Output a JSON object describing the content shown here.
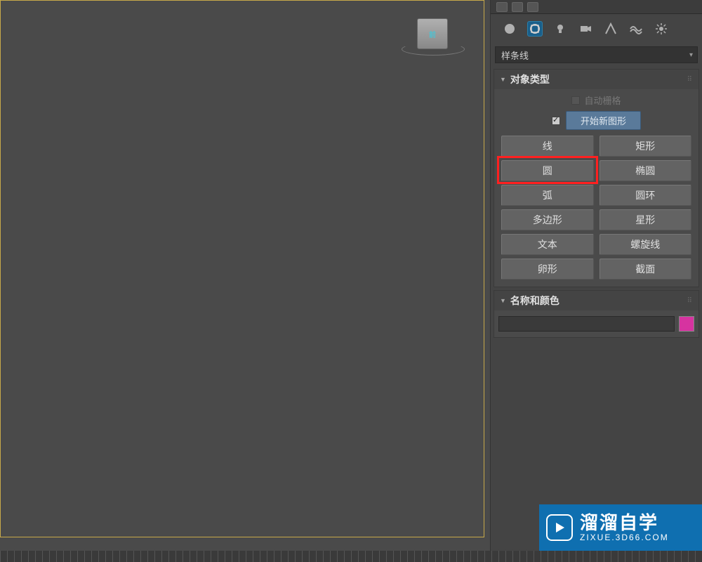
{
  "viewcube_label": "前",
  "dropdown": {
    "selected": "样条线"
  },
  "rollouts": {
    "object_type": {
      "title": "对象类型",
      "auto_grid_label": "自动栅格",
      "new_shape_label": "开始新图形",
      "new_shape_checked": true,
      "buttons": [
        {
          "label": "线"
        },
        {
          "label": "矩形"
        },
        {
          "label": "圆"
        },
        {
          "label": "椭圆"
        },
        {
          "label": "弧"
        },
        {
          "label": "圆环"
        },
        {
          "label": "多边形"
        },
        {
          "label": "星形"
        },
        {
          "label": "文本"
        },
        {
          "label": "螺旋线"
        },
        {
          "label": "卵形"
        },
        {
          "label": "截面"
        }
      ]
    },
    "name_color": {
      "title": "名称和颜色",
      "name_value": "",
      "color": "#d633a0"
    }
  },
  "watermark": {
    "main": "溜溜自学",
    "sub": "ZIXUE.3D66.COM"
  },
  "highlighted_button_index": 2
}
